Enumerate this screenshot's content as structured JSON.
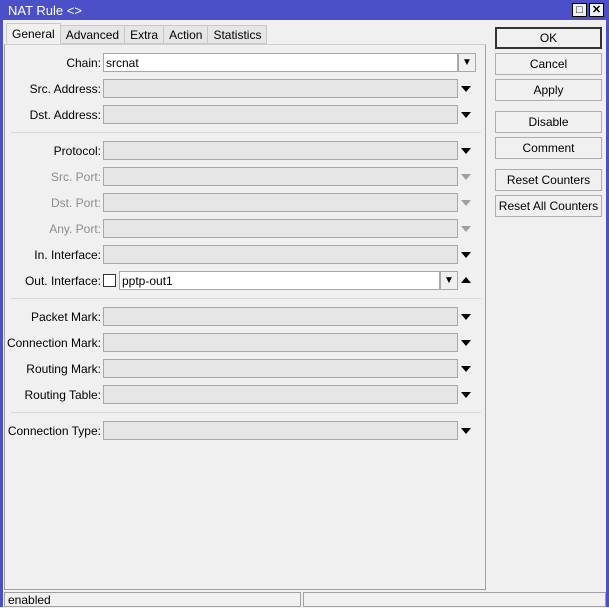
{
  "window": {
    "title": "NAT Rule <>",
    "maximize_icon": "maximize-icon",
    "close_icon": "close-icon"
  },
  "tabs": [
    {
      "label": "General",
      "active": true
    },
    {
      "label": "Advanced"
    },
    {
      "label": "Extra"
    },
    {
      "label": "Action"
    },
    {
      "label": "Statistics"
    }
  ],
  "fields": {
    "chain": {
      "label": "Chain:",
      "value": "srcnat"
    },
    "src_address": {
      "label": "Src. Address:"
    },
    "dst_address": {
      "label": "Dst. Address:"
    },
    "protocol": {
      "label": "Protocol:"
    },
    "src_port": {
      "label": "Src. Port:",
      "disabled": true
    },
    "dst_port": {
      "label": "Dst. Port:",
      "disabled": true
    },
    "any_port": {
      "label": "Any. Port:",
      "disabled": true
    },
    "in_interface": {
      "label": "In. Interface:"
    },
    "out_interface": {
      "label": "Out. Interface:",
      "value": "pptp-out1",
      "negate": false
    },
    "packet_mark": {
      "label": "Packet Mark:"
    },
    "connection_mark": {
      "label": "Connection Mark:"
    },
    "routing_mark": {
      "label": "Routing Mark:"
    },
    "routing_table": {
      "label": "Routing Table:"
    },
    "connection_type": {
      "label": "Connection Type:"
    }
  },
  "buttons": {
    "ok": "OK",
    "cancel": "Cancel",
    "apply": "Apply",
    "disable": "Disable",
    "comment": "Comment",
    "reset_counters": "Reset Counters",
    "reset_all_counters": "Reset All Counters"
  },
  "status": {
    "left": "enabled",
    "right": ""
  },
  "colors": {
    "titlebar": "#4b4fc8"
  }
}
